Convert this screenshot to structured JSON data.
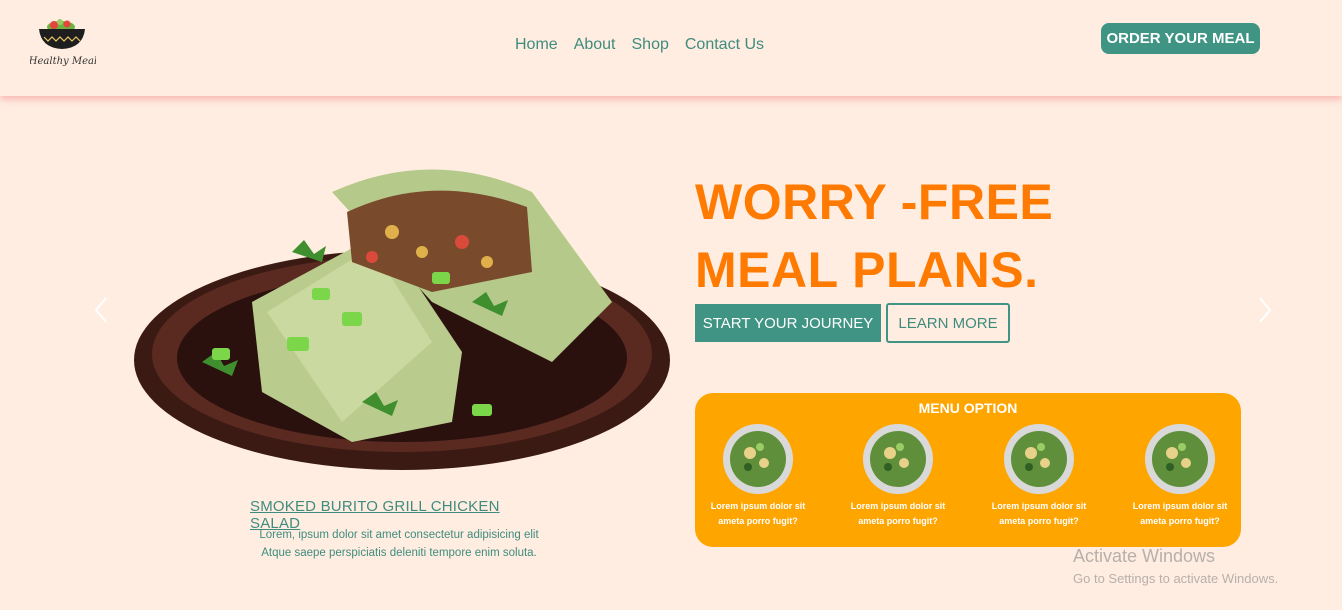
{
  "header": {
    "logo_text": "Healthy Meal",
    "nav": [
      "Home",
      "About",
      "Shop",
      "Contact Us"
    ],
    "order_button": "ORDER YOUR MEAL"
  },
  "hero": {
    "headline_line1": "WORRY -FREE",
    "headline_line2": "MEAL PLANS.",
    "primary_button": "START YOUR JOURNEY",
    "secondary_button": "LEARN MORE",
    "image_icon": "burrito-plate-image",
    "caption_title": "SMOKED BURITO GRILL CHICKEN SALAD",
    "caption_line1": "Lorem, ipsum dolor sit amet consectetur adipisicing elit",
    "caption_line2": "Atque saepe perspiciatis deleniti tempore enim soluta.",
    "prev_icon": "chevron-left-icon",
    "next_icon": "chevron-right-icon"
  },
  "menu": {
    "title": "MENU OPTION",
    "items": [
      {
        "line1": "Lorem ipsum dolor sit",
        "line2": "ameta porro fugit?"
      },
      {
        "line1": "Lorem ipsum dolor sit",
        "line2": "ameta porro fugit?"
      },
      {
        "line1": "Lorem ipsum dolor sit",
        "line2": "ameta porro fugit?"
      },
      {
        "line1": "Lorem ipsum dolor sit",
        "line2": "ameta porro fugit?"
      }
    ]
  },
  "watermark": {
    "line1": "Activate Windows",
    "line2": "Go to Settings to activate Windows."
  },
  "colors": {
    "background": "#ffede1",
    "accent_teal": "#3f9483",
    "headline_orange": "#ff7a00",
    "menu_card": "#ffa500"
  }
}
